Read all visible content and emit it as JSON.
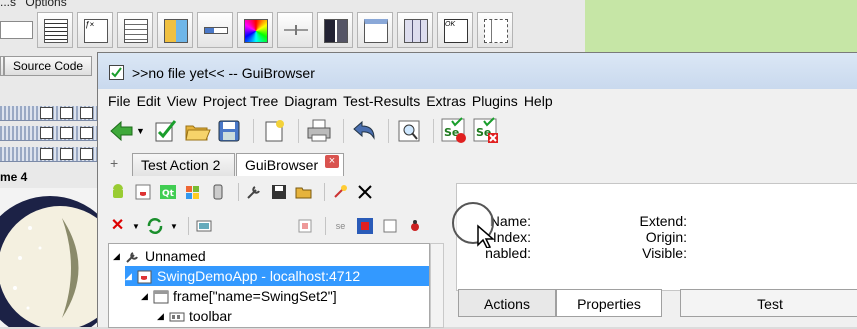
{
  "background_app": {
    "menu_items": [
      "...s",
      "Options"
    ],
    "tabs": [
      "Source Code"
    ],
    "internal_frame_label": "me 4"
  },
  "window": {
    "title": ">>no file yet<< -- GuiBrowser",
    "menu": [
      "File",
      "Edit",
      "View",
      "Project Tree",
      "Diagram",
      "Test-Results",
      "Extras",
      "Plugins",
      "Help"
    ],
    "toolbar_icons": [
      "back-arrow-icon",
      "new-check-icon",
      "open-folder-icon",
      "save-icon",
      "new-document-icon",
      "print-icon",
      "undo-icon",
      "inspect-icon",
      "selenium-record-icon",
      "selenium-stop-icon"
    ],
    "tabs": [
      {
        "label": "Test Action 2"
      },
      {
        "label": "GuiBrowser"
      }
    ],
    "tab_add_label": "+"
  },
  "left_panel": {
    "platform_icons": [
      "android-icon",
      "java-icon",
      "qt-icon",
      "windows-icon",
      "mobile-icon"
    ],
    "tree": {
      "root": "Unnamed",
      "selected": "SwingDemoApp - localhost:4712",
      "frame": "frame[\"name=SwingSet2\"]",
      "toolbar": "toolbar"
    }
  },
  "properties": {
    "left": [
      {
        "label": "Name:"
      },
      {
        "label": "Index:"
      },
      {
        "label": "nabled:"
      }
    ],
    "right": [
      {
        "label": "Extend:"
      },
      {
        "label": "Origin:"
      },
      {
        "label": "Visible:"
      }
    ]
  },
  "bottom_tabs": {
    "actions": "Actions",
    "properties": "Properties",
    "test": "Test"
  },
  "colors": {
    "selection": "#3399ff",
    "titlebar": "#dbe7f5",
    "bg_green": "#c6e6a6"
  }
}
